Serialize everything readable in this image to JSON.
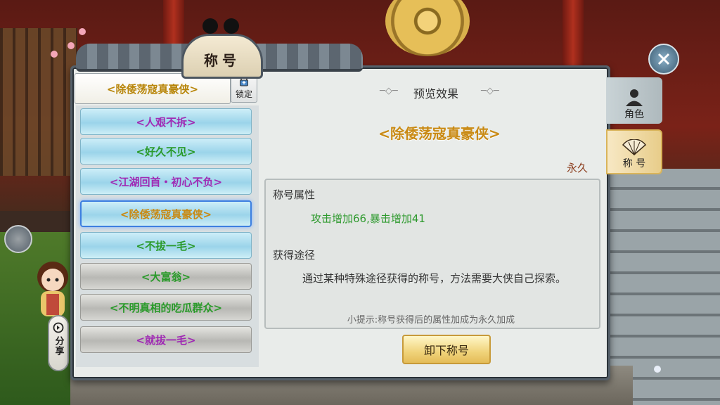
{
  "window": {
    "title": "称号"
  },
  "current_title": "<除倭荡寇真豪侠>",
  "lock_label": "锁定",
  "title_list": [
    {
      "label": "<人艰不拆>",
      "style": "blue",
      "color": "#a02ab4",
      "selected": false
    },
    {
      "label": "<好久不见>",
      "style": "blue",
      "color": "#2a9a2a",
      "selected": false
    },
    {
      "label": "<江湖回首・初心不负>",
      "style": "blue",
      "color": "#a02ab4",
      "selected": false
    },
    {
      "label": "<除倭荡寇真豪侠>",
      "style": "blue",
      "color": "#c98a14",
      "selected": true
    },
    {
      "label": "<不拔一毛>",
      "style": "blue",
      "color": "#2a9a2a",
      "selected": false
    },
    {
      "label": "<大富翁>",
      "style": "gray",
      "color": "#2a9a2a",
      "selected": false
    },
    {
      "label": "<不明真相的吃瓜群众>",
      "style": "gray",
      "color": "#2a9a2a",
      "selected": false
    },
    {
      "label": "<就拔一毛>",
      "style": "gray",
      "color": "#a02ab4",
      "selected": false
    }
  ],
  "preview": {
    "heading": "预览效果",
    "title_name": "<除倭荡寇真豪侠>",
    "duration": "永久",
    "attr_label": "称号属性",
    "attr_value": "攻击增加66,暴击增加41",
    "source_label": "获得途径",
    "source_text": "通过某种特殊途径获得的称号，方法需要大侠自己探索。",
    "tip": "小提示:称号获得后的属性加成为永久加成",
    "unequip_label": "卸下称号"
  },
  "side_tabs": [
    {
      "label": "角色",
      "icon": "character-icon"
    },
    {
      "label": "称 号",
      "icon": "fan-icon",
      "active": true
    }
  ],
  "share_label": "分享",
  "colors": {
    "title_gold": "#c98a14",
    "attr_green": "#2f9a2f",
    "duration_brown": "#8a3a1a"
  }
}
